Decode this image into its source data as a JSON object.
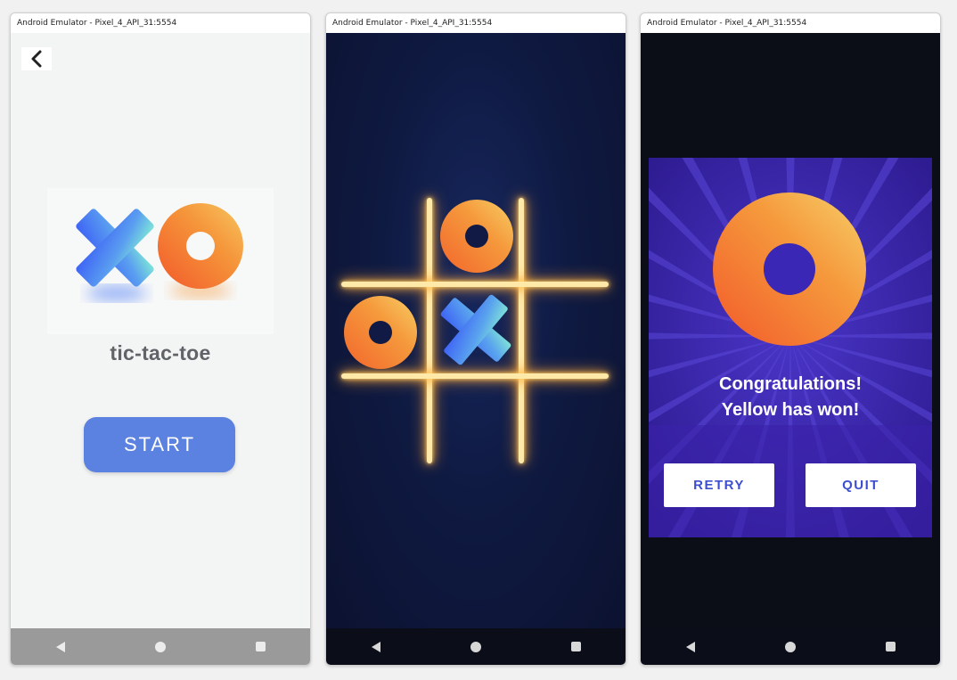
{
  "windows": [
    {
      "title": "Android Emulator - Pixel_4_API_31:5554",
      "screen": "start",
      "app_name": "tic-tac-toe",
      "start_label": "START"
    },
    {
      "title": "Android Emulator - Pixel_4_API_31:5554",
      "screen": "game-board",
      "board": [
        "",
        "O",
        "",
        "O",
        "X",
        "",
        "",
        "",
        ""
      ]
    },
    {
      "title": "Android Emulator - Pixel_4_API_31:5554",
      "screen": "result",
      "congrats_line1": "Congratulations!",
      "congrats_line2": "Yellow has won!",
      "retry_label": "RETRY",
      "quit_label": "QUIT"
    }
  ],
  "colors": {
    "start_button": "#5b82e0",
    "panel": "#3a22a8",
    "glow": "#ffb347",
    "x_blue": "#4a7cf0",
    "o_orange": "#f28a30"
  },
  "icons": [
    "back-icon",
    "nav-back-icon",
    "nav-home-icon",
    "nav-recents-icon",
    "x-piece-icon",
    "o-piece-icon"
  ]
}
